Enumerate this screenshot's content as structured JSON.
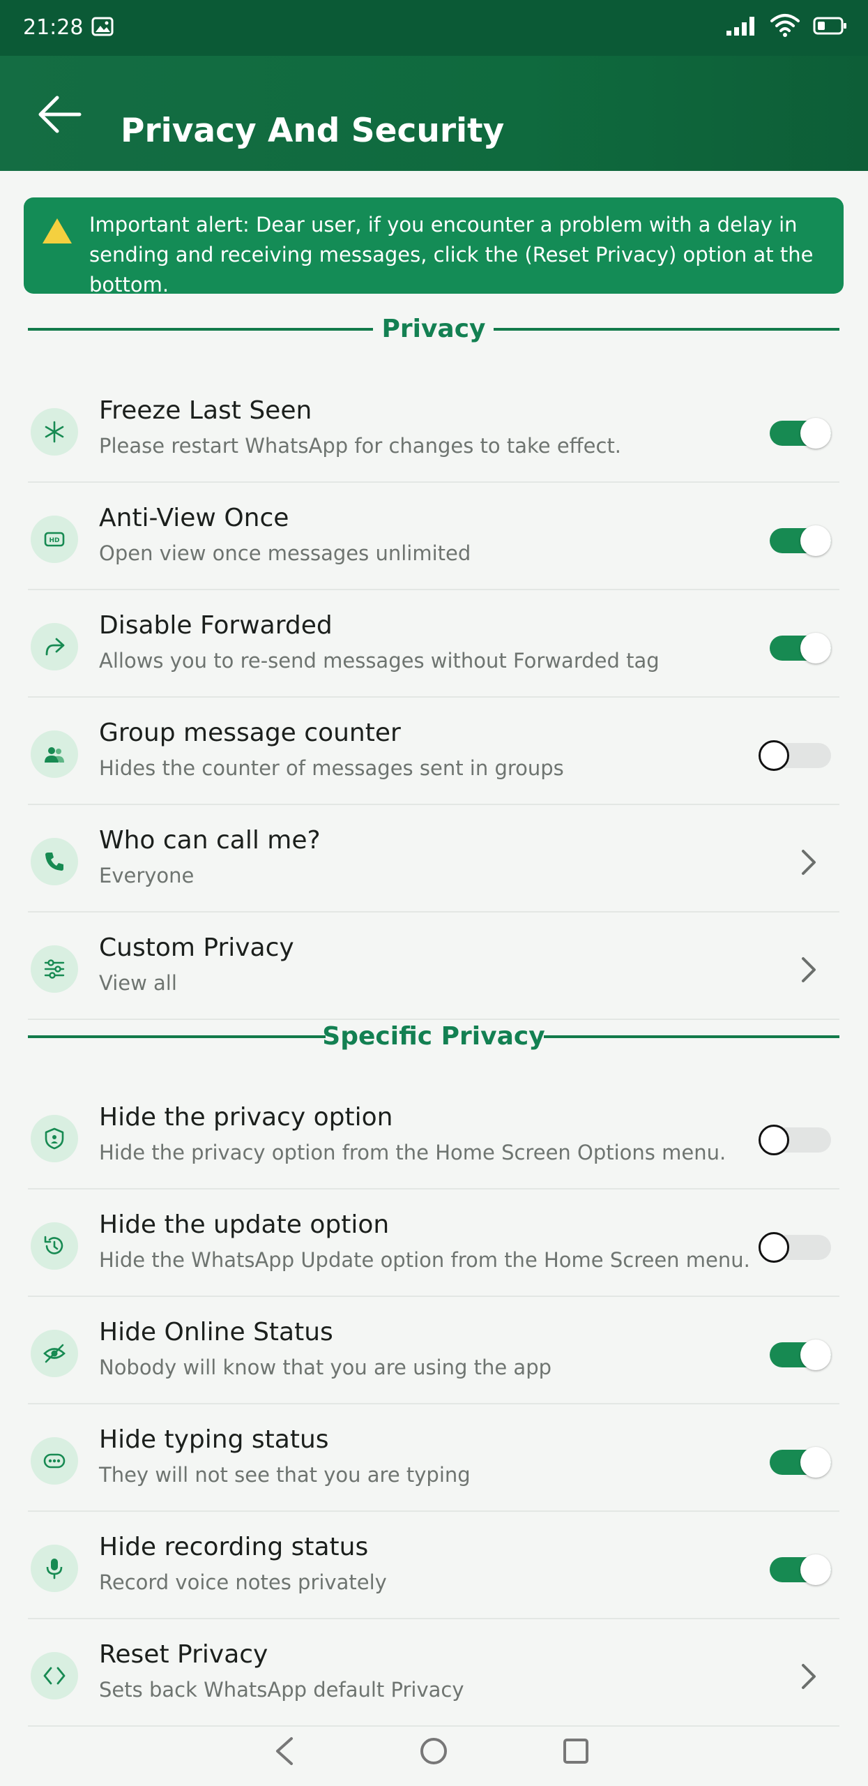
{
  "status_bar": {
    "time": "21:28"
  },
  "header": {
    "title": "Privacy And Security"
  },
  "alert": {
    "text": "Important alert: Dear user, if you encounter a problem with a delay in sending and receiving messages, click the (Reset Privacy) option at the bottom."
  },
  "sections": {
    "privacy": "Privacy",
    "specific_privacy": "Specific Privacy"
  },
  "privacy_items": [
    {
      "title": "Freeze Last Seen",
      "subtitle": "Please restart WhatsApp for changes to take effect.",
      "control": "toggle",
      "on": true,
      "icon": "freeze-icon"
    },
    {
      "title": "Anti-View Once",
      "subtitle": "Open view once messages unlimited",
      "control": "toggle",
      "on": true,
      "icon": "hd-icon"
    },
    {
      "title": "Disable Forwarded",
      "subtitle": "Allows you to re-send messages without Forwarded tag",
      "control": "toggle",
      "on": true,
      "icon": "forward-icon"
    },
    {
      "title": "Group message counter",
      "subtitle": "Hides the counter of messages sent in groups",
      "control": "toggle",
      "on": false,
      "icon": "group-icon"
    },
    {
      "title": "Who can call me?",
      "subtitle": "Everyone",
      "control": "chevron",
      "icon": "phone-icon"
    },
    {
      "title": "Custom Privacy",
      "subtitle": "View all",
      "control": "chevron",
      "icon": "sliders-icon"
    }
  ],
  "specific_items": [
    {
      "title": "Hide the privacy option",
      "subtitle": "Hide the privacy option from the Home Screen Options menu.",
      "control": "toggle",
      "on": false,
      "icon": "shield-icon"
    },
    {
      "title": "Hide the update option",
      "subtitle": "Hide the WhatsApp Update option from the Home Screen menu.",
      "control": "toggle",
      "on": false,
      "icon": "history-icon"
    },
    {
      "title": "Hide Online Status",
      "subtitle": "Nobody will know that you are using the app",
      "control": "toggle",
      "on": true,
      "icon": "eye-off-icon"
    },
    {
      "title": "Hide typing status",
      "subtitle": "They will not see that you are typing",
      "control": "toggle",
      "on": true,
      "icon": "typing-icon"
    },
    {
      "title": "Hide recording status",
      "subtitle": "Record voice notes privately",
      "control": "toggle",
      "on": true,
      "icon": "mic-icon"
    },
    {
      "title": "Reset Privacy",
      "subtitle": "Sets back WhatsApp default Privacy",
      "control": "chevron",
      "icon": "code-icon"
    }
  ],
  "colors": {
    "primary": "#0f6a3e",
    "accent": "#138052",
    "toggle_on": "#178a52",
    "alert_bg": "#148c56",
    "warning": "#f4d03f"
  }
}
